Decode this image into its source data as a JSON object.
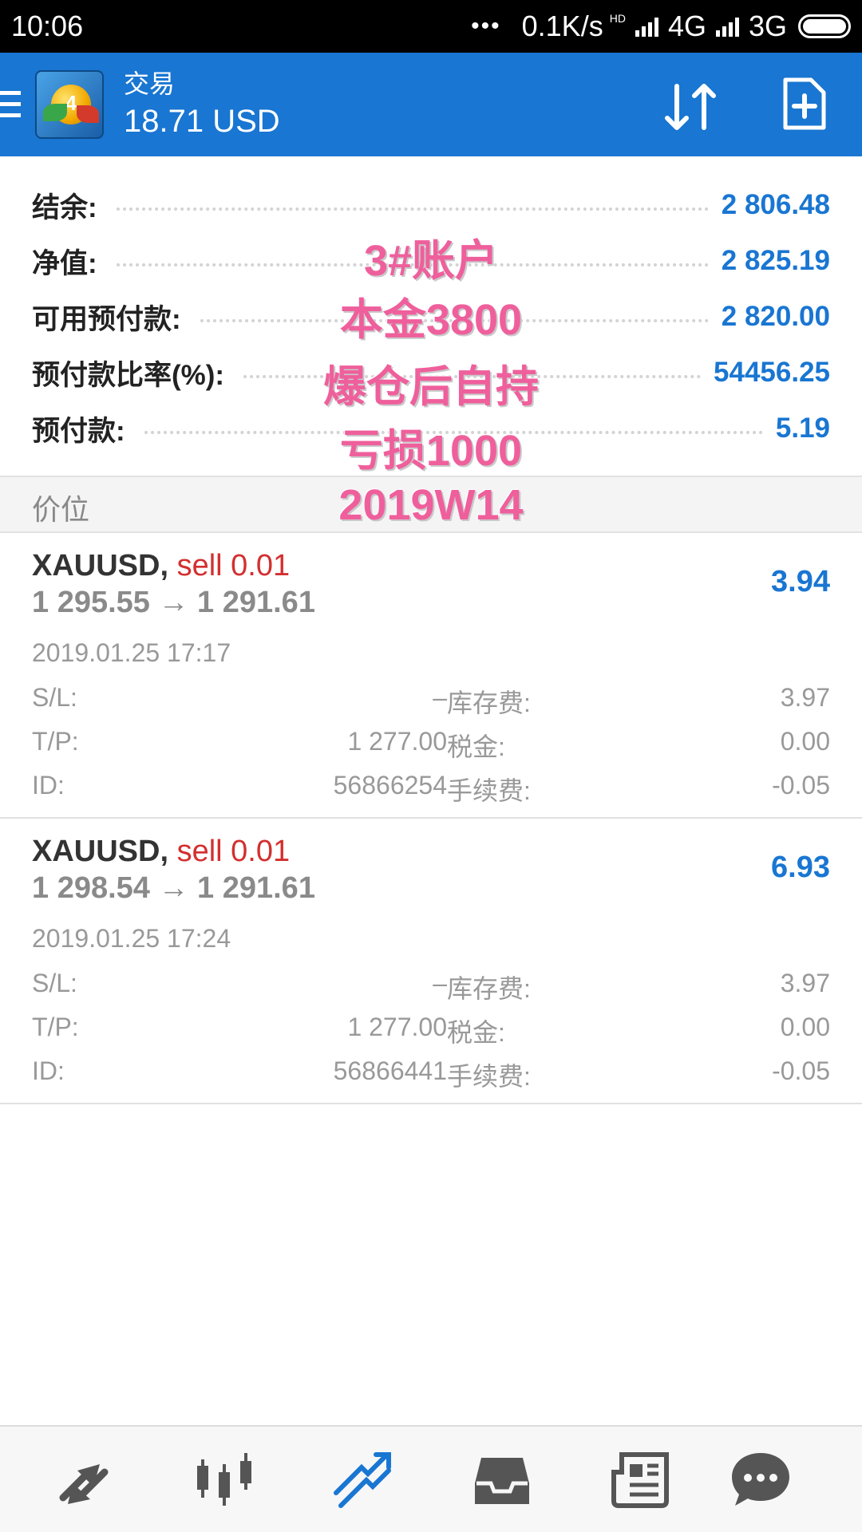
{
  "status_bar": {
    "time": "10:06",
    "more": "•••",
    "net_speed": "0.1K/s",
    "net_hd": "HD",
    "net1": "4G",
    "net2": "3G"
  },
  "header": {
    "title": "交易",
    "subtitle": "18.71 USD",
    "icons": [
      "menu-icon",
      "app-logo",
      "sort-icon",
      "new-order-icon"
    ]
  },
  "summary": [
    {
      "label": "结余:",
      "value": "2 806.48"
    },
    {
      "label": "净值:",
      "value": "2 825.19"
    },
    {
      "label": "可用预付款:",
      "value": "2 820.00"
    },
    {
      "label": "预付款比率(%):",
      "value": "54456.25"
    },
    {
      "label": "预付款:",
      "value": "5.19"
    }
  ],
  "watermark": [
    "3#账户",
    "本金3800",
    "爆仓后自持",
    "亏损1000",
    "2019W14"
  ],
  "section_title": "价位",
  "trades": [
    {
      "symbol": "XAUUSD,",
      "side": "sell 0.01",
      "prices": "1 295.55 → 1 291.61",
      "profit": "3.94",
      "date": "2019.01.25 17:17",
      "sl_label": "S/L:",
      "sl": "–",
      "tp_label": "T/P:",
      "tp": "1 277.00",
      "id_label": "ID:",
      "id": "56866254",
      "swap_label": "库存费:",
      "swap": "3.97",
      "tax_label": "税金:",
      "tax": "0.00",
      "fee_label": "手续费:",
      "fee": "-0.05"
    },
    {
      "symbol": "XAUUSD,",
      "side": "sell 0.01",
      "prices": "1 298.54 → 1 291.61",
      "profit": "6.93",
      "date": "2019.01.25 17:24",
      "sl_label": "S/L:",
      "sl": "–",
      "tp_label": "T/P:",
      "tp": "1 277.00",
      "id_label": "ID:",
      "id": "56866441",
      "swap_label": "库存费:",
      "swap": "3.97",
      "tax_label": "税金:",
      "tax": "0.00",
      "fee_label": "手续费:",
      "fee": "-0.05"
    }
  ],
  "bottom_nav": [
    {
      "icon": "quotes-icon",
      "active": false
    },
    {
      "icon": "chart-icon",
      "active": false
    },
    {
      "icon": "trade-icon",
      "active": true
    },
    {
      "icon": "history-icon",
      "active": false
    },
    {
      "icon": "news-icon",
      "active": false
    },
    {
      "icon": "chat-icon",
      "active": false
    }
  ],
  "colors": {
    "accent": "#1976d2",
    "sell": "#d32f2f",
    "watermark": "#ef5f9c"
  }
}
